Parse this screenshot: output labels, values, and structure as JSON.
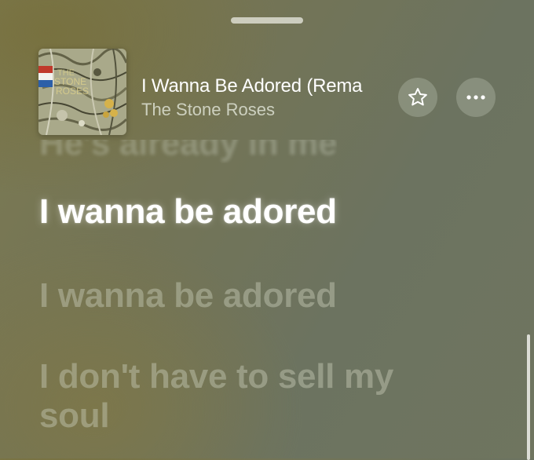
{
  "now_playing": {
    "title": "I Wanna Be Adored (Rema",
    "artist": "The Stone Roses",
    "album_art_icon": "album-art-the-stone-roses"
  },
  "actions": {
    "favorite_icon": "star-icon",
    "more_icon": "ellipsis-icon"
  },
  "lyrics": {
    "previous": "He's already in me",
    "current": "I wanna be adored",
    "next": [
      "I wanna be adored",
      "I don't have to sell my soul"
    ]
  },
  "colors": {
    "accent_text": "#ffffff",
    "background": "#737456"
  }
}
